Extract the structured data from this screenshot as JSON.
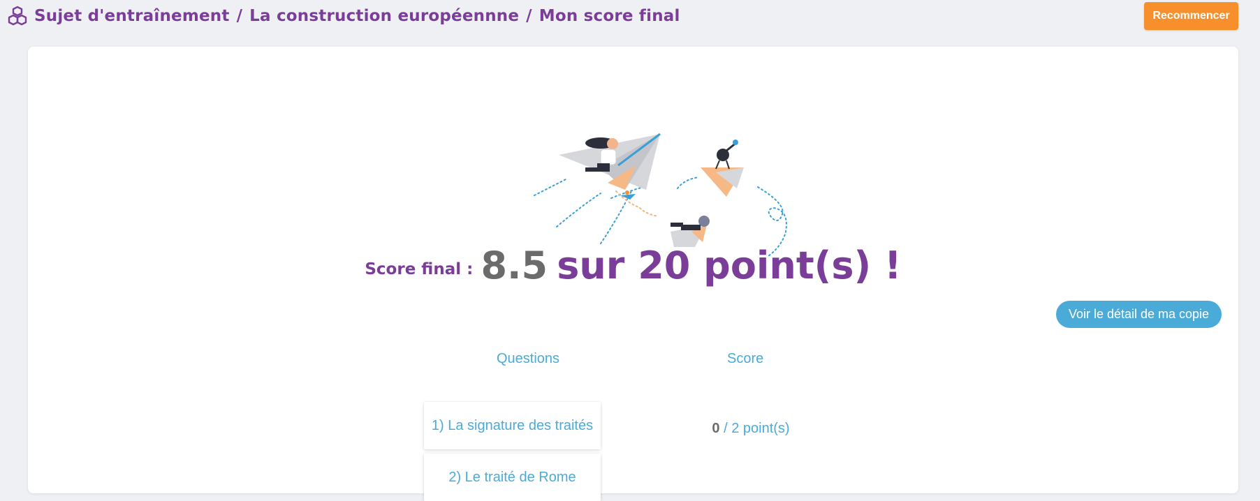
{
  "header": {
    "breadcrumb": [
      "Sujet d'entraînement",
      "La construction européennne",
      "Mon score final"
    ],
    "separator": "/",
    "restart_label": "Recommencer"
  },
  "result": {
    "label": "Score final :",
    "score": "8.5",
    "total_text": "sur 20 point(s) !",
    "detail_button": "Voir le détail de ma copie"
  },
  "table": {
    "questions_header": "Questions",
    "score_header": "Score",
    "rows": [
      {
        "question": "1) La signature des traités",
        "score": "0",
        "max": "/ 2 point(s)"
      },
      {
        "question": "2) Le traité de Rome",
        "score": "",
        "max": ""
      }
    ]
  },
  "colors": {
    "purple": "#7a3e99",
    "orange": "#f7902c",
    "blue": "#4aabd8",
    "grey": "#6b6b6b"
  }
}
